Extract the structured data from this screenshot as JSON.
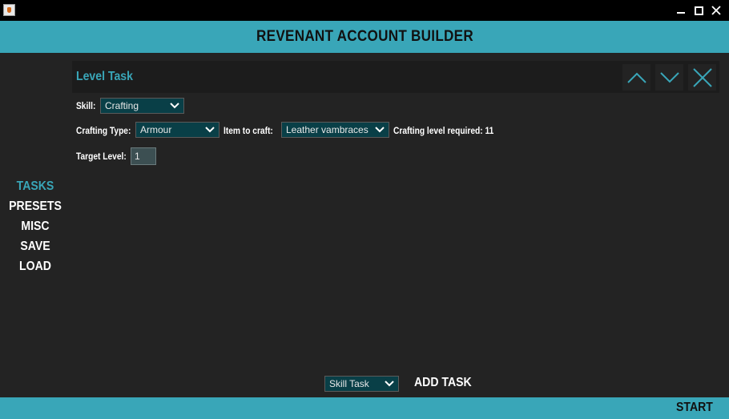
{
  "window": {
    "title": ""
  },
  "header": {
    "title": "REVENANT ACCOUNT BUILDER"
  },
  "sidebar": {
    "items": [
      {
        "label": "TASKS",
        "active": true
      },
      {
        "label": "PRESETS",
        "active": false
      },
      {
        "label": "MISC",
        "active": false
      },
      {
        "label": "SAVE",
        "active": false
      },
      {
        "label": "LOAD",
        "active": false
      }
    ]
  },
  "task": {
    "title": "Level Task",
    "skill_label": "Skill:",
    "skill_value": "Crafting",
    "crafting_type_label": "Crafting Type:",
    "crafting_type_value": "Armour",
    "item_label": "Item to craft:",
    "item_value": "Leather vambraces",
    "level_required_text": "Crafting level required: 11",
    "target_level_label": "Target Level:",
    "target_level_value": "1"
  },
  "add_task": {
    "type_value": "Skill Task",
    "label": "ADD TASK"
  },
  "footer": {
    "start_label": "START"
  },
  "colors": {
    "accent": "#39a6b8",
    "background": "#232323",
    "select_bg": "#093f47",
    "titlebar": "#000000"
  },
  "icons": [
    "java-app-icon",
    "minimize-icon",
    "maximize-icon",
    "close-icon",
    "chevron-up-icon",
    "chevron-down-icon",
    "remove-icon"
  ]
}
